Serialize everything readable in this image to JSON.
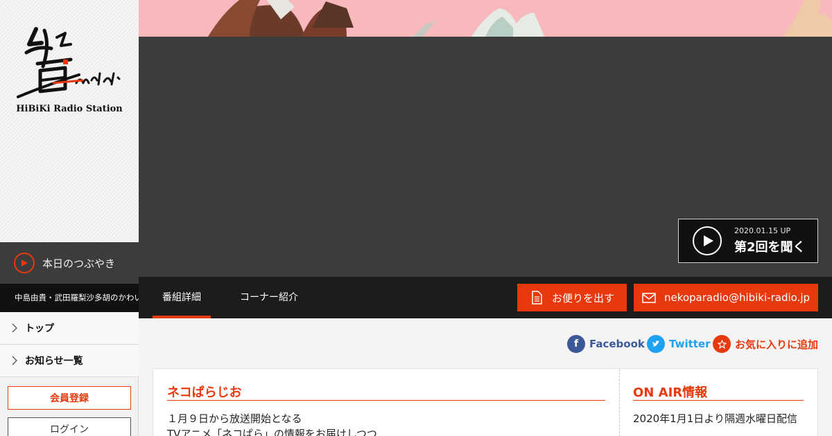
{
  "sidebar": {
    "logo_text": "HiBiKi Radio Station",
    "tsubuyaki_label": "本日のつぶやき",
    "ticker_text": "中島由貴・武田羅梨沙多胡のかわいいねこの話",
    "nav": [
      {
        "label": "トップ"
      },
      {
        "label": "お知らせ一覧"
      }
    ],
    "register_label": "会員登録",
    "login_label": "ログイン"
  },
  "player": {
    "date": "2020.01.15 UP",
    "title": "第2回を聞く"
  },
  "tabs": {
    "detail": "番組詳細",
    "corner": "コーナー紹介",
    "letter_button": "お便りを出す",
    "email_button": "nekoparadio@hibiki-radio.jp"
  },
  "social": {
    "facebook": "Facebook",
    "twitter": "Twitter",
    "favorite": "お気に入りに追加"
  },
  "program": {
    "title": "ネコぱらじお",
    "line1": "１月９日から放送開始となる",
    "line2": "TVアニメ「ネコぱら」の情報をお届けしつつ"
  },
  "onair": {
    "title": "ON AIR情報",
    "text": "2020年1月1日より隔週水曜日配信"
  },
  "colors": {
    "accent": "#e8380d",
    "dark": "#1c1c1c",
    "player_bg": "#3c3c3c",
    "facebook": "#3b5998",
    "twitter": "#1da1f2"
  },
  "icons": {
    "play": "play-icon",
    "chevron": "chevron-right-icon",
    "document": "document-icon",
    "mail": "mail-icon",
    "star": "star-icon"
  }
}
